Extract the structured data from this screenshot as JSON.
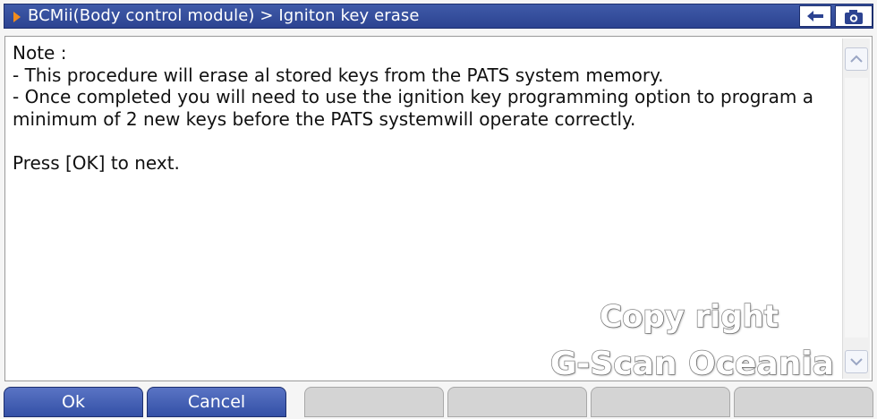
{
  "titlebar": {
    "title": "BCMii(Body control module) > Igniton key erase",
    "back_icon": "left-arrow-icon",
    "camera_icon": "camera-icon"
  },
  "content": {
    "lines": [
      "Note :",
      "- This procedure will erase al stored keys from the PATS system memory.",
      "- Once completed you will need to use the ignition key programming option to program a minimum of 2 new keys before the PATS systemwill operate correctly.",
      "",
      "Press [OK] to next."
    ]
  },
  "watermark": {
    "line1": "Copy right",
    "line2": "G-Scan Oceania"
  },
  "buttons": {
    "ok_label": "Ok",
    "cancel_label": "Cancel"
  },
  "colors": {
    "title_bar": "#2c4391",
    "accent_arrow": "#f28c1c",
    "active_button": "#3350a6",
    "inactive_button": "#d4d4d4"
  }
}
